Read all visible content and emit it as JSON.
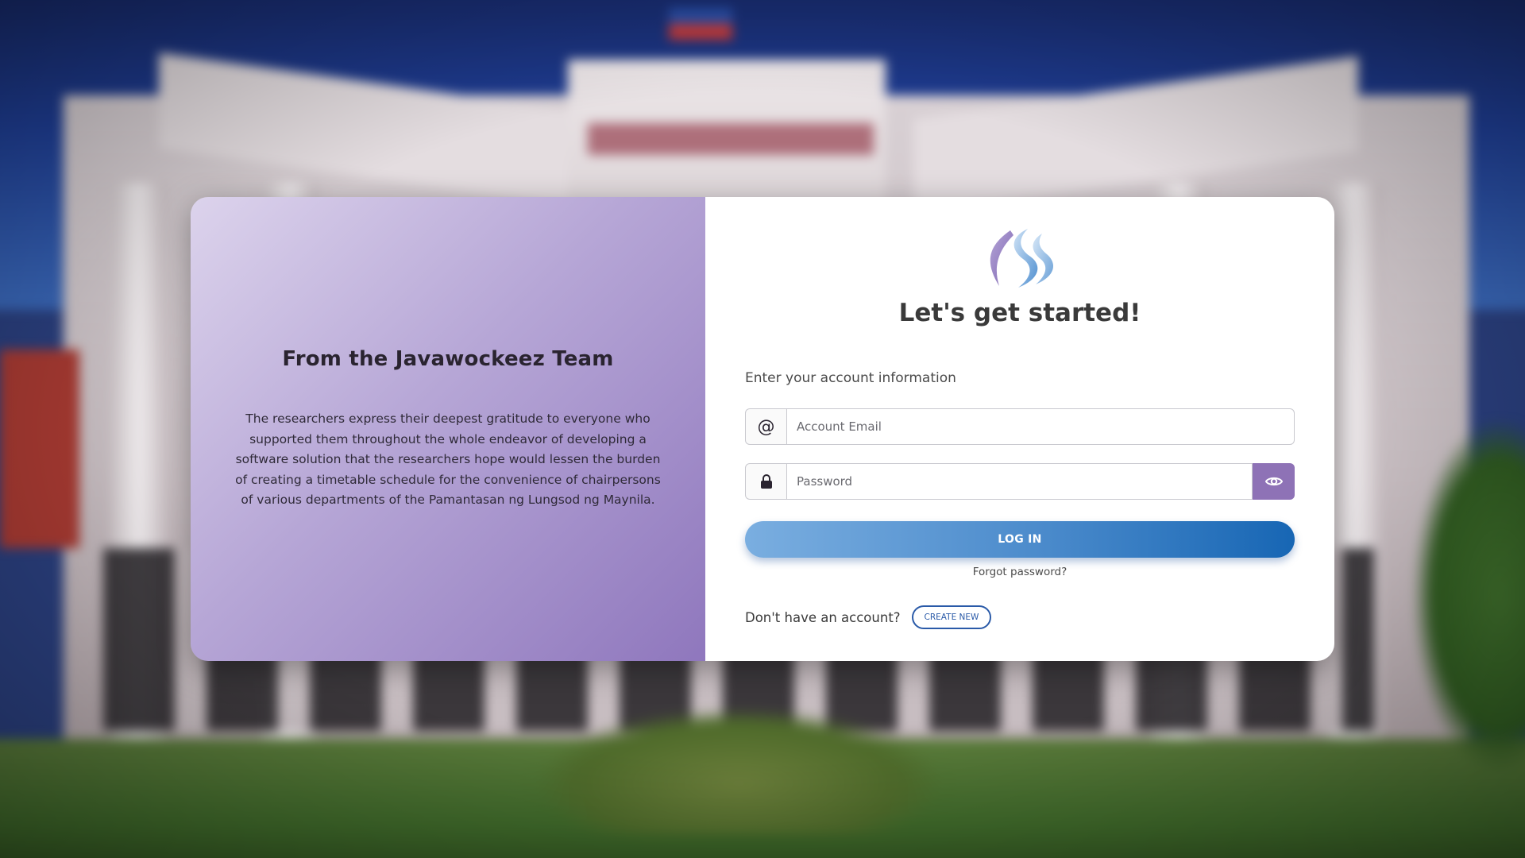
{
  "left_panel": {
    "title": "From the Javawockeez Team",
    "body": "The researchers express their deepest gratitude to everyone who supported them throughout the whole endeavor of developing a software solution that the researchers hope would lessen the burden of creating a timetable schedule for the convenience of chairpersons of various departments of the Pamantasan ng Lungsod ng Maynila."
  },
  "login": {
    "logo_icon": "app-logo",
    "heading": "Let's get started!",
    "subheading": "Enter your account information",
    "email": {
      "icon": "at-sign-icon",
      "placeholder": "Account Email",
      "value": ""
    },
    "password": {
      "icon": "lock-icon",
      "placeholder": "Password",
      "value": "",
      "toggle_icon": "eye-icon"
    },
    "login_label": "LOG IN",
    "forgot_label": "Forgot password?",
    "no_account_label": "Don't have an account?",
    "create_label": "CREATE NEW"
  },
  "colors": {
    "accent_purple": "#8e72b6",
    "login_gradient_start": "#7aaee0",
    "login_gradient_end": "#1766b4",
    "create_border": "#2a5aa8"
  }
}
